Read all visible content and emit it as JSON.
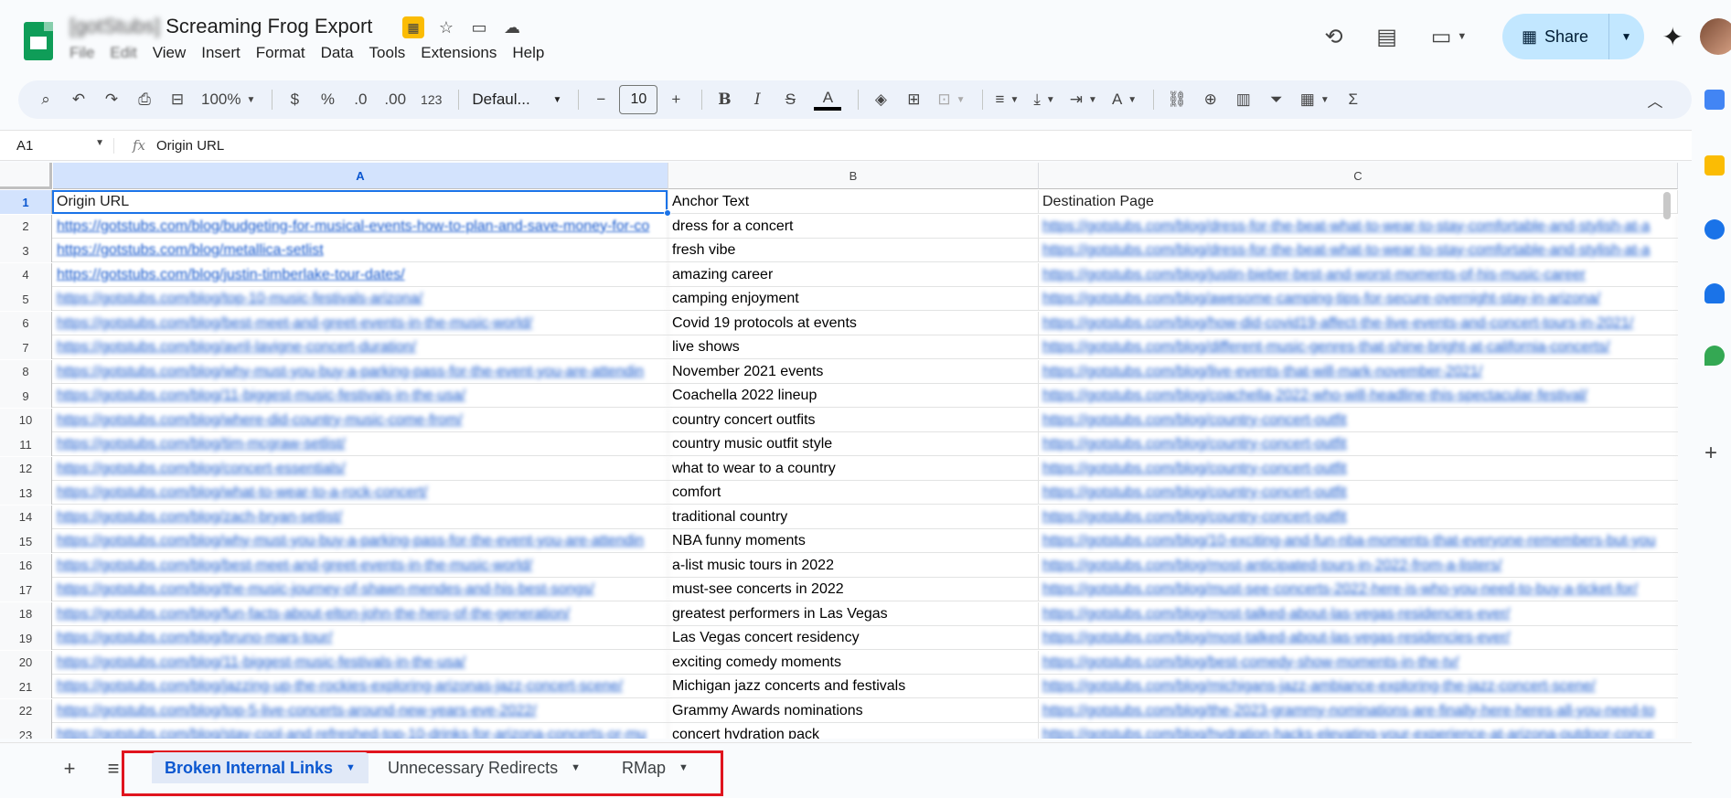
{
  "doc": {
    "title_blurred": "[gotStubs]",
    "title": "Screaming Frog Export",
    "menu": [
      "File",
      "Edit",
      "View",
      "Insert",
      "Format",
      "Data",
      "Tools",
      "Extensions",
      "Help"
    ],
    "share_label": "Share"
  },
  "toolbar": {
    "zoom": "100%",
    "currency": "$",
    "percent": "%",
    "dec_decrease": ".0",
    "dec_increase": ".00",
    "number_format": "123",
    "font": "Defaul...",
    "font_size": "10",
    "bold": "B",
    "italic": "I",
    "strike": "S",
    "text_color": "A"
  },
  "formula_bar": {
    "cell_ref": "A1",
    "fx": "fx",
    "value": "Origin URL"
  },
  "columns": [
    "A",
    "B",
    "C"
  ],
  "rows": [
    {
      "n": "1",
      "a": "Origin URL",
      "b": "Anchor Text",
      "c": "Destination Page"
    },
    {
      "n": "2",
      "a": "https://gotstubs.com/blog/budgeting-for-musical-events-how-to-plan-and-save-money-for-co",
      "b": "dress for a concert",
      "c": "https://gotstubs.com/blog/dress-for-the-beat-what-to-wear-to-stay-comfortable-and-stylish-at-a"
    },
    {
      "n": "3",
      "a": "https://gotstubs.com/blog/metallica-setlist",
      "b": "fresh vibe",
      "c": "https://gotstubs.com/blog/dress-for-the-beat-what-to-wear-to-stay-comfortable-and-stylish-at-a"
    },
    {
      "n": "4",
      "a": "https://gotstubs.com/blog/justin-timberlake-tour-dates/",
      "b": "amazing career",
      "c": "https://gotstubs.com/blog/justin-bieber-best-and-worst-moments-of-his-music-career"
    },
    {
      "n": "5",
      "a": "https://gotstubs.com/blog/top-10-music-festivals-arizona/",
      "b": "camping enjoyment",
      "c": "https://gotstubs.com/blog/awesome-camping-tips-for-secure-overnight-stay-in-arizona/"
    },
    {
      "n": "6",
      "a": "https://gotstubs.com/blog/best-meet-and-greet-events-in-the-music-world/",
      "b": "Covid 19 protocols at events",
      "c": "https://gotstubs.com/blog/how-did-covid19-affect-the-live-events-and-concert-tours-in-2021/"
    },
    {
      "n": "7",
      "a": "https://gotstubs.com/blog/avril-lavigne-concert-duration/",
      "b": "live shows",
      "c": "https://gotstubs.com/blog/different-music-genres-that-shine-bright-at-california-concerts/"
    },
    {
      "n": "8",
      "a": "https://gotstubs.com/blog/why-must-you-buy-a-parking-pass-for-the-event-you-are-attendin",
      "b": "November 2021 events",
      "c": "https://gotstubs.com/blog/live-events-that-will-mark-november-2021/"
    },
    {
      "n": "9",
      "a": "https://gotstubs.com/blog/11-biggest-music-festivals-in-the-usa/",
      "b": "Coachella 2022 lineup",
      "c": "https://gotstubs.com/blog/coachella-2022-who-will-headline-this-spectacular-festival/"
    },
    {
      "n": "10",
      "a": "https://gotstubs.com/blog/where-did-country-music-come-from/",
      "b": "country concert outfits",
      "c": "https://gotstubs.com/blog/country-concert-outfit"
    },
    {
      "n": "11",
      "a": "https://gotstubs.com/blog/tim-mcgraw-setlist/",
      "b": "country music outfit style",
      "c": "https://gotstubs.com/blog/country-concert-outfit"
    },
    {
      "n": "12",
      "a": "https://gotstubs.com/blog/concert-essentials/",
      "b": "what to wear to a country",
      "c": "https://gotstubs.com/blog/country-concert-outfit"
    },
    {
      "n": "13",
      "a": "https://gotstubs.com/blog/what-to-wear-to-a-rock-concert/",
      "b": "comfort",
      "c": "https://gotstubs.com/blog/country-concert-outfit"
    },
    {
      "n": "14",
      "a": "https://gotstubs.com/blog/zach-bryan-setlist/",
      "b": "traditional country",
      "c": "https://gotstubs.com/blog/country-concert-outfit"
    },
    {
      "n": "15",
      "a": "https://gotstubs.com/blog/why-must-you-buy-a-parking-pass-for-the-event-you-are-attendin",
      "b": "NBA funny moments",
      "c": "https://gotstubs.com/blog/10-exciting-and-fun-nba-moments-that-everyone-remembers-but-you"
    },
    {
      "n": "16",
      "a": "https://gotstubs.com/blog/best-meet-and-greet-events-in-the-music-world/",
      "b": "a-list music tours in 2022",
      "c": "https://gotstubs.com/blog/most-anticipated-tours-in-2022-from-a-listers/"
    },
    {
      "n": "17",
      "a": "https://gotstubs.com/blog/the-music-journey-of-shawn-mendes-and-his-best-songs/",
      "b": "must-see concerts in 2022",
      "c": "https://gotstubs.com/blog/must-see-concerts-2022-here-is-who-you-need-to-buy-a-ticket-for/"
    },
    {
      "n": "18",
      "a": "https://gotstubs.com/blog/fun-facts-about-elton-john-the-hero-of-the-generation/",
      "b": "greatest performers in Las Vegas",
      "c": "https://gotstubs.com/blog/most-talked-about-las-vegas-residencies-ever/"
    },
    {
      "n": "19",
      "a": "https://gotstubs.com/blog/bruno-mars-tour/",
      "b": "Las Vegas concert residency",
      "c": "https://gotstubs.com/blog/most-talked-about-las-vegas-residencies-ever/"
    },
    {
      "n": "20",
      "a": "https://gotstubs.com/blog/11-biggest-music-festivals-in-the-usa/",
      "b": "exciting comedy moments",
      "c": "https://gotstubs.com/blog/best-comedy-show-moments-in-the-tv/"
    },
    {
      "n": "21",
      "a": "https://gotstubs.com/blog/jazzing-up-the-rockies-exploring-arizonas-jazz-concert-scene/",
      "b": "Michigan jazz concerts and festivals",
      "c": "https://gotstubs.com/blog/michigans-jazz-ambiance-exploring-the-jazz-concert-scene/"
    },
    {
      "n": "22",
      "a": "https://gotstubs.com/blog/top-5-live-concerts-around-new-years-eve-2022/",
      "b": "Grammy Awards nominations",
      "c": "https://gotstubs.com/blog/the-2023-grammy-nominations-are-finally-here-heres-all-you-need-to"
    },
    {
      "n": "23",
      "a": "https://gotstubs.com/blog/stay-cool-and-refreshed-top-10-drinks-for-arizona-concerts-or-mu",
      "b": "concert hydration pack",
      "c": "https://gotstubs.com/blog/hydration-hacks-elevating-your-experience-at-arizona-outdoor-conce"
    }
  ],
  "sheets": {
    "add": "+",
    "list": "≡",
    "tabs": [
      "Broken Internal Links",
      "Unnecessary Redirects",
      "RMap"
    ],
    "active": "Broken Internal Links"
  },
  "colors": {
    "accent": "#1a73e8",
    "link": "#1155cc",
    "share_bg": "#c2e7ff",
    "highlight_box": "#e0141e",
    "sheets_green": "#0f9d58"
  }
}
